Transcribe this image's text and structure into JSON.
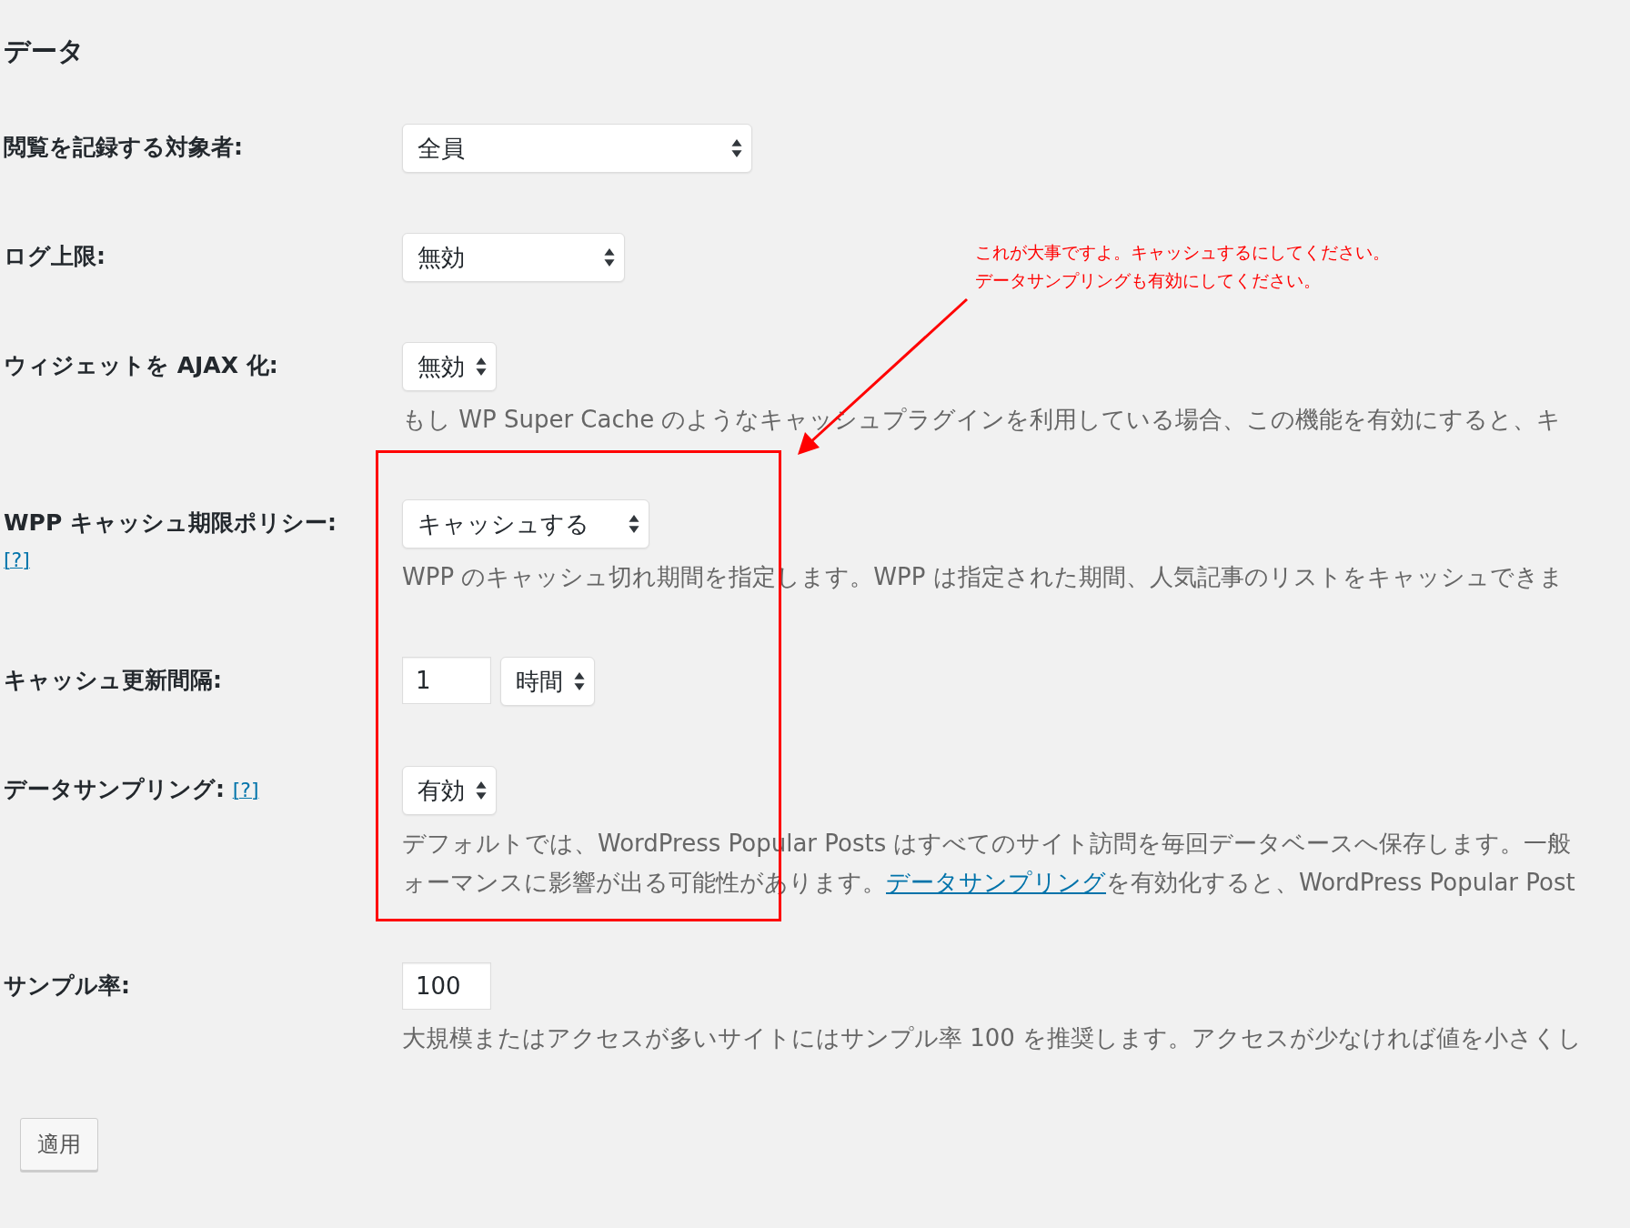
{
  "heading": "データ",
  "rows": [
    {
      "label": "閲覧を記録する対象者:",
      "controls": [
        {
          "kind": "select",
          "value": "全員"
        }
      ]
    },
    {
      "label": "ログ上限:",
      "controls": [
        {
          "kind": "select",
          "value": "無効"
        }
      ]
    },
    {
      "label": "ウィジェットを AJAX 化:",
      "controls": [
        {
          "kind": "select",
          "value": "無効"
        }
      ],
      "description": [
        [
          {
            "text": "もし WP Super Cache のようなキャッシュプラグインを利用している場合、この機能を有効にすると、キ"
          }
        ]
      ]
    },
    {
      "label": "WPP キャッシュ期限ポリシー:",
      "help": "[?]",
      "controls": [
        {
          "kind": "select",
          "value": "キャッシュする"
        }
      ],
      "description": [
        [
          {
            "text": "WPP のキャッシュ切れ期間を指定します。WPP は指定された期間、人気記事のリストをキャッシュできま"
          }
        ]
      ]
    },
    {
      "label": "キャッシュ更新間隔:",
      "controls": [
        {
          "kind": "input",
          "value": "1"
        },
        {
          "kind": "select",
          "value": "時間"
        }
      ]
    },
    {
      "label": "データサンプリング:",
      "help": "[?]",
      "controls": [
        {
          "kind": "select",
          "value": "有効"
        }
      ],
      "description": [
        [
          {
            "text": "デフォルトでは、WordPress Popular Posts はすべてのサイト訪問を毎回データベースへ保存します。一般"
          }
        ],
        [
          {
            "text": "ォーマンスに影響が出る可能性があります。"
          },
          {
            "kind": "link",
            "text": "データサンプリング"
          },
          {
            "text": "を有効化すると、WordPress Popular Post"
          }
        ]
      ]
    },
    {
      "label": "サンプル率:",
      "controls": [
        {
          "kind": "input",
          "value": "100"
        }
      ],
      "description": [
        [
          {
            "text": "大規模またはアクセスが多いサイトにはサンプル率 100 を推奨します。アクセスが少なければ値を小さくし"
          }
        ]
      ]
    }
  ],
  "submit": "適用",
  "annotation": {
    "lines": [
      "これが大事ですよ。キャッシュするにしてください。",
      "データサンプリングも有効にしてください。"
    ]
  }
}
